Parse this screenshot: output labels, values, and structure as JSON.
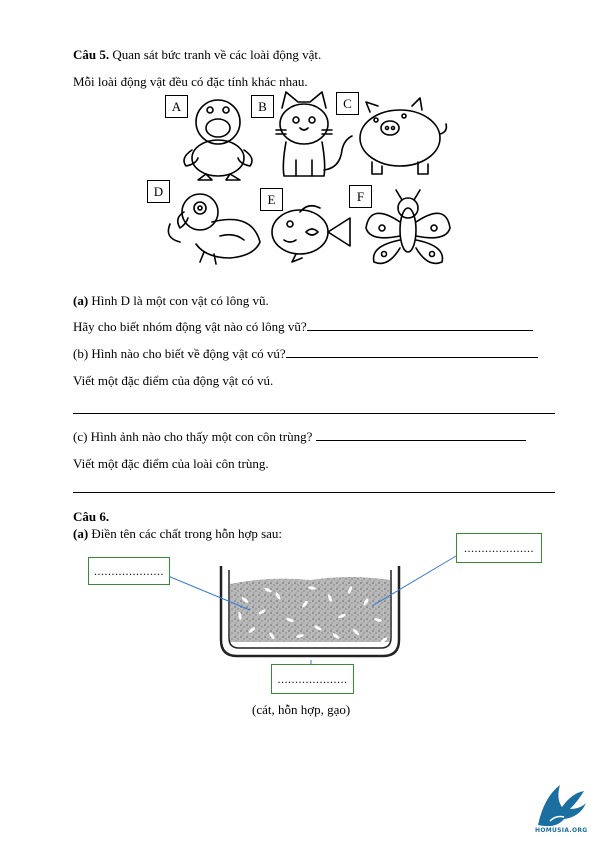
{
  "q5": {
    "title": "Câu 5.",
    "intro": "Quan sát bức tranh về các loài động vật.",
    "line2": "Mỗi loài động vật đều có đặc tính khác nhau.",
    "labels": [
      "A",
      "B",
      "C",
      "D",
      "E",
      "F"
    ],
    "a_prefix": "(a)",
    "a_text": "Hình D là một con vật có lông vũ.",
    "a_question": "Hãy cho biết nhóm động vật nào có lông vũ?",
    "b_question": "(b) Hình nào cho biết về động vật có vú?",
    "b_follow": "Viết một đặc điểm của động vật có vú.",
    "c_question": "(c) Hình ảnh nào cho thấy một con côn trùng?",
    "c_follow": "Viết một đặc điểm của loài côn trùng."
  },
  "q6": {
    "title": "Câu 6.",
    "a_prefix": "(a)",
    "a_text": "Điền tên các chất trong hỗn hợp sau:",
    "blank_left": "....................",
    "blank_right": "....................",
    "blank_bottom": "....................",
    "options": "(cát, hỗn hợp, gạo)"
  },
  "logo": {
    "text": "HOMUSIA.ORG",
    "color": "#1a6fa0"
  }
}
